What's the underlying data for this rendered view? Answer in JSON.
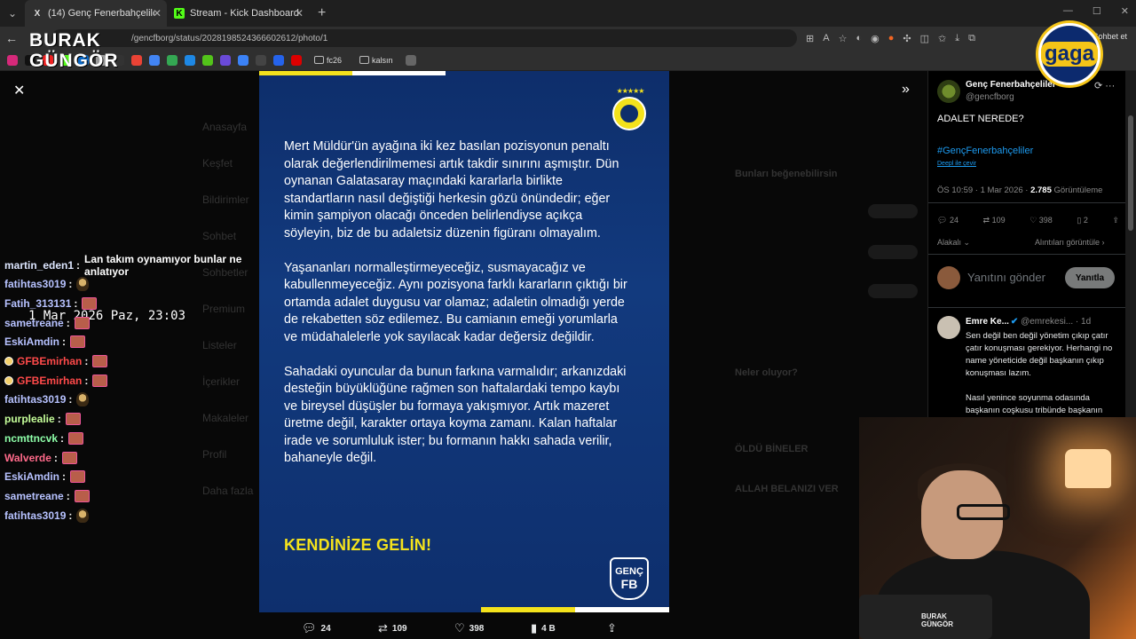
{
  "browser": {
    "tabs": [
      {
        "label": "(14) Genç Fenerbahçeliler (@genc",
        "favicon": "X",
        "active": true
      },
      {
        "label": "Stream - Kick Dashboard",
        "favicon": "K",
        "active": false
      }
    ],
    "url": "/gencfborg/status/2028198524366602612/photo/1",
    "right_label": "Sohbet et",
    "bookmarks": [
      {
        "icon": "instagram-icon",
        "color": "#d6297a"
      },
      {
        "icon": "x-icon",
        "color": "#111"
      },
      {
        "icon": "youtube-icon",
        "color": "#e22"
      },
      {
        "icon": "kick-icon",
        "color": "#53fc18"
      },
      {
        "icon": "linkedin-icon",
        "color": "#0a66c2"
      },
      {
        "icon": "app-icon",
        "color": "#999"
      },
      {
        "icon": "app-icon",
        "color": "#333"
      },
      {
        "icon": "gmail-icon",
        "color": "#ea4335"
      },
      {
        "icon": "docs-icon",
        "color": "#4285f4"
      },
      {
        "icon": "drive-icon",
        "color": "#34a853"
      },
      {
        "icon": "app-icon",
        "color": "#1e88e5"
      },
      {
        "icon": "app-icon",
        "color": "#53c41a"
      },
      {
        "icon": "app-icon",
        "color": "#6a4ad8"
      },
      {
        "icon": "app-icon",
        "color": "#3b82f6"
      },
      {
        "icon": "app-icon",
        "color": "#444"
      },
      {
        "icon": "app-icon",
        "color": "#2563eb"
      },
      {
        "icon": "app-icon",
        "color": "#d00"
      },
      {
        "icon": "app-icon",
        "color": "#666"
      }
    ],
    "bookmark_folders": [
      "fc26",
      "kalsın"
    ]
  },
  "overlay": {
    "streamer_logo_line1": "BURAK",
    "streamer_logo_line2": "GÜNGÖR",
    "gaga_logo": "gaga",
    "datetime": "1 Mar 2026 Paz, 23:03"
  },
  "post_image": {
    "paragraphs": [
      "Mert Müldür'ün ayağına iki kez basılan pozisyonun penaltı olarak değerlendirilmemesi artık takdir sınırını aşmıştır. Dün oynanan Galatasaray maçındaki kararlarla birlikte standartların nasıl değiştiği herkesin gözü önündedir; eğer kimin şampiyon olacağı önceden belirlendiyse açıkça söyleyin, biz de bu adaletsiz düzenin figüranı olmayalım.",
      "Yaşananları normalleştirmeyeceğiz, susmayacağız ve kabullenmeyeceğiz. Aynı pozisyona farklı kararların çıktığı bir ortamda adalet duygusu var olamaz; adaletin olmadığı yerde de rekabetten söz edilemez. Bu camianın emeği yorumlarla ve müdahalelerle yok sayılacak kadar değersiz değildir.",
      "Sahadaki oyuncular da bunun farkına varmalıdır; arkanızdaki desteğin büyüklüğüne rağmen son haftalardaki tempo kaybı ve bireysel düşüşler bu formaya yakışmıyor. Artık mazeret üretme değil, karakter ortaya koyma zamanı. Kalan haftalar irade ve sorumluluk ister; bu formanın hakkı sahada verilir, bahaneyle değil."
    ],
    "slogan": "KENDİNİZE GELİN!",
    "badge_line1": "GENÇ",
    "badge_line2": "FB"
  },
  "viewer_actions": {
    "replies": "24",
    "reposts": "109",
    "likes": "398",
    "views": "4 B"
  },
  "chat": [
    {
      "user": "martin_eden1",
      "color": "#dde6ff",
      "message": "Lan takım oynamıyor bunlar ne anlatıyor",
      "emote": "",
      "badge": false
    },
    {
      "user": "fatihtas3019",
      "color": "#b7c2ff",
      "message": "",
      "emote": "small",
      "badge": false
    },
    {
      "user": "Fatih_313131",
      "color": "#b7c2ff",
      "message": "",
      "emote": "box",
      "badge": false
    },
    {
      "user": "sametreane",
      "color": "#b7c2ff",
      "message": "",
      "emote": "box",
      "badge": false
    },
    {
      "user": "EskiAmdin",
      "color": "#b7c2ff",
      "message": "",
      "emote": "box",
      "badge": false
    },
    {
      "user": "GFBEmirhan",
      "color": "#ff4a4a",
      "message": "",
      "emote": "box",
      "badge": true
    },
    {
      "user": "GFBEmirhan",
      "color": "#ff4a4a",
      "message": "",
      "emote": "box",
      "badge": true
    },
    {
      "user": "fatihtas3019",
      "color": "#b7c2ff",
      "message": "",
      "emote": "small",
      "badge": false
    },
    {
      "user": "purplealie",
      "color": "#c6ff9a",
      "message": "",
      "emote": "box",
      "badge": false
    },
    {
      "user": "ncmttncvk",
      "color": "#8effa9",
      "message": "",
      "emote": "box",
      "badge": false
    },
    {
      "user": "Walverde",
      "color": "#ff6a8a",
      "message": "",
      "emote": "box",
      "badge": false
    },
    {
      "user": "EskiAmdin",
      "color": "#b7c2ff",
      "message": "",
      "emote": "box",
      "badge": false
    },
    {
      "user": "sametreane",
      "color": "#b7c2ff",
      "message": "",
      "emote": "box",
      "badge": false
    },
    {
      "user": "fatihtas3019",
      "color": "#b7c2ff",
      "message": "",
      "emote": "small",
      "badge": false
    }
  ],
  "side_panel": {
    "name": "Genç Fenerbahçeliler",
    "handle": "@gencfborg",
    "text": "ADALET NEREDE?",
    "hashtag": "#GençFenerbahçeliler",
    "translate": "Deepl ile çevir",
    "meta_prefix": "ÖS 10:59 · 1 Mar 2026 · ",
    "meta_views": "2.785",
    "meta_suffix": " Görüntüleme",
    "actions": {
      "replies": "24",
      "reposts": "109",
      "likes": "398",
      "bookmarks": "2"
    },
    "sort_label": "Alakalı",
    "quotes_label": "Alıntıları görüntüle",
    "reply_placeholder": "Yanıtını gönder",
    "reply_button": "Yanıtla",
    "comment": {
      "name": "Emre Ke...",
      "handle": "@emrekesi... · 1d",
      "text": "Sen değil ben değil yönetim çıkıp çatır çatır konuşması gerekiyor. Herhangi no name yöneticide değil başkanın çıkıp konuşması lazım.",
      "text2": "Nasıl yenince soyunma odasında başkanın coşkusu tribünde başkanın"
    }
  },
  "background_nav": [
    "Anasayfa",
    "Keşfet",
    "Bildirimler",
    "Sohbet",
    "Sohbetler",
    "Premium",
    "Listeler",
    "İçerikler",
    "Makaleler",
    "Profil",
    "Daha fazla"
  ],
  "background_right": [
    "Bunları beğenebilirsin",
    "Neler oluyor?",
    "ÖLDÜ BİNELER",
    "ALLAH BELANIZI VER"
  ],
  "colors": {
    "fb_navy": "#0e2e6b",
    "fb_yellow": "#f4e21c",
    "x_blue": "#1d9bf0"
  }
}
